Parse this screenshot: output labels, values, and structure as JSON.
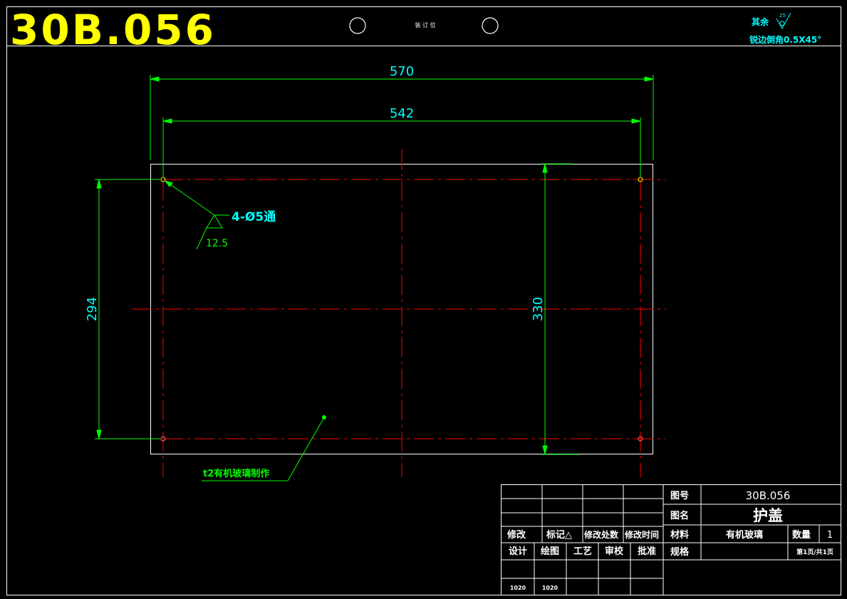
{
  "header": {
    "drawing_code_large": "30B.056",
    "binding_label": "装 订 位",
    "roughness_label": "其余",
    "roughness_value": "25",
    "edge_note": "锐边倒角0.5X45°"
  },
  "dimensions": {
    "overall_width": "570",
    "hole_spacing_x": "542",
    "hole_spacing_y": "294",
    "overall_height": "330"
  },
  "annotations": {
    "holes": "4-Ø5通",
    "hole_roughness": "12.5",
    "material_note": "t2有机玻璃制作"
  },
  "title_block": {
    "drawing_no_label": "图号",
    "drawing_no": "30B.056",
    "name_label": "图名",
    "name": "护盖",
    "material_label": "材料",
    "material": "有机玻璃",
    "qty_label": "数量",
    "qty": "1",
    "spec_label": "规格",
    "sheet": "第1页/共1页",
    "revision_headers": [
      "修改",
      "标记△",
      "修改处数",
      "修改时间"
    ],
    "signoff_headers": [
      "设计",
      "绘图",
      "工艺",
      "审校",
      "批准"
    ],
    "design_value": "1020",
    "draw_value": "1020"
  },
  "colors": {
    "background": "#000000",
    "border": "#ffffff",
    "dimension": "#00ff00",
    "centerline": "#ff0000",
    "dim_text": "#00ffff",
    "note_text": "#00ff00",
    "code_text": "#ffff00"
  }
}
